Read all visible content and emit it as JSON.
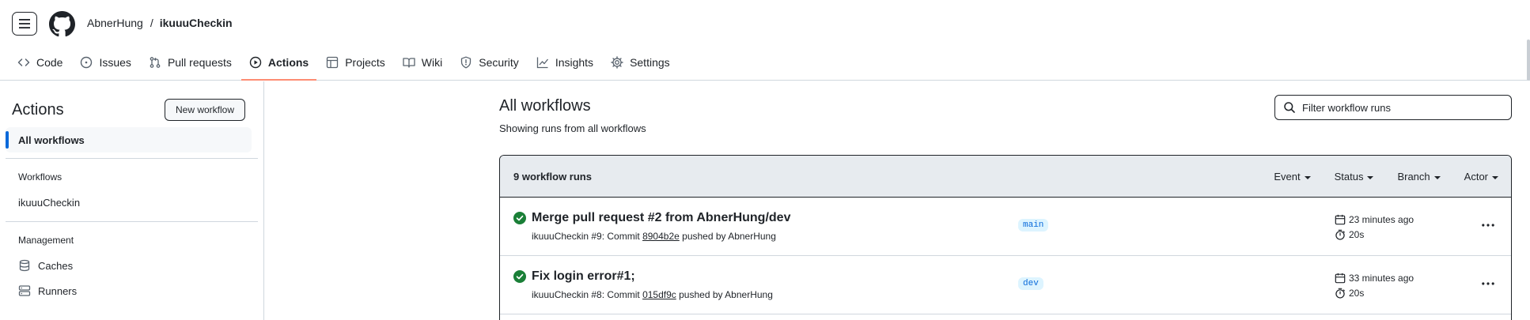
{
  "header": {
    "owner": "AbnerHung",
    "separator": "/",
    "repo": "ikuuuCheckin"
  },
  "tabs": [
    {
      "label": "Code",
      "icon": "code-icon"
    },
    {
      "label": "Issues",
      "icon": "issue-opened-icon"
    },
    {
      "label": "Pull requests",
      "icon": "git-pull-request-icon"
    },
    {
      "label": "Actions",
      "icon": "play-icon",
      "selected": true
    },
    {
      "label": "Projects",
      "icon": "table-icon"
    },
    {
      "label": "Wiki",
      "icon": "book-icon"
    },
    {
      "label": "Security",
      "icon": "shield-icon"
    },
    {
      "label": "Insights",
      "icon": "graph-icon"
    },
    {
      "label": "Settings",
      "icon": "gear-icon"
    }
  ],
  "sidebar": {
    "title": "Actions",
    "new_workflow_label": "New workflow",
    "all_workflows_label": "All workflows",
    "workflows_heading": "Workflows",
    "workflows": [
      "ikuuuCheckin"
    ],
    "management_heading": "Management",
    "management": [
      {
        "label": "Caches",
        "icon": "database-icon"
      },
      {
        "label": "Runners",
        "icon": "server-icon"
      }
    ]
  },
  "main": {
    "title": "All workflows",
    "subtitle": "Showing runs from all workflows",
    "filter_placeholder": "Filter workflow runs",
    "runs_count": "9 workflow runs",
    "filters": [
      "Event",
      "Status",
      "Branch",
      "Actor"
    ],
    "runs": [
      {
        "title": "Merge pull request #2 from AbnerHung/dev",
        "workflow": "ikuuuCheckin #9: Commit",
        "sha": "8904b2e",
        "pushed_by": "pushed by AbnerHung",
        "branch": "main",
        "when": "23 minutes ago",
        "duration": "20s",
        "status": "success"
      },
      {
        "title": "Fix login error#1;",
        "workflow": "ikuuuCheckin #8: Commit",
        "sha": "015df9c",
        "pushed_by": "pushed by AbnerHung",
        "branch": "dev",
        "when": "33 minutes ago",
        "duration": "20s",
        "status": "success"
      }
    ]
  },
  "colors": {
    "accent_underline": "#fd8c73",
    "success": "#1a7f37",
    "link_blue": "#0969da",
    "branch_bg": "#ddf4ff"
  }
}
